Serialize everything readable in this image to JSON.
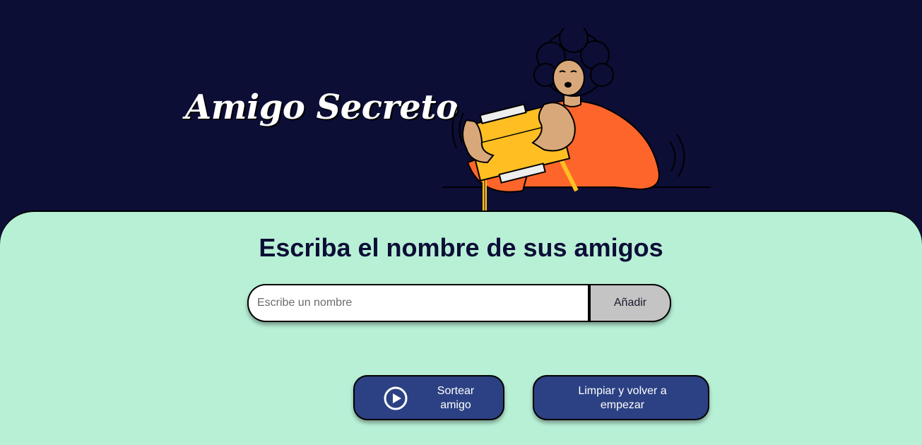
{
  "header": {
    "title": "Amigo Secreto",
    "illustration_icon": "person-holding-gift-illustration"
  },
  "main": {
    "section_title": "Escriba el nombre de sus amigos",
    "name_input": {
      "placeholder": "Escribe un nombre",
      "value": ""
    },
    "add_button_label": "Añadir",
    "draw_button": {
      "label": "Sortear amigo",
      "icon": "play-circle-icon"
    },
    "reset_button_label": "Limpiar y volver a empezar"
  },
  "colors": {
    "header_bg": "#0c0e36",
    "panel_bg": "#b8f0d6",
    "button_bg": "#2b4183",
    "add_button_bg": "#c4c4c4",
    "accent_orange": "#fe652b",
    "accent_yellow": "#ffbf23"
  }
}
